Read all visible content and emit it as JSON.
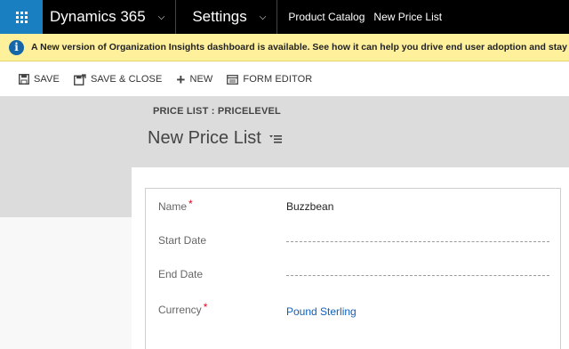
{
  "topbar": {
    "app_name": "Dynamics 365",
    "area": "Settings",
    "breadcrumb": [
      "Product Catalog",
      "New Price List"
    ]
  },
  "notification": {
    "text": "A New version of Organization Insights dashboard is available. See how it can help you drive end user adoption and stay ahead o"
  },
  "commands": {
    "save": "SAVE",
    "save_close": "SAVE & CLOSE",
    "new": "NEW",
    "form_editor": "FORM EDITOR"
  },
  "header": {
    "entity": "PRICE LIST : PRICELEVEL",
    "title": "New Price List"
  },
  "form": {
    "name_label": "Name",
    "name_value": "Buzzbean",
    "start_label": "Start Date",
    "end_label": "End Date",
    "currency_label": "Currency",
    "currency_value": "Pound Sterling",
    "required_marker": "*"
  },
  "colors": {
    "accent": "#1a7fc0",
    "notify_bg": "#fff09c",
    "link": "#1160b7",
    "required": "#e0001b"
  }
}
